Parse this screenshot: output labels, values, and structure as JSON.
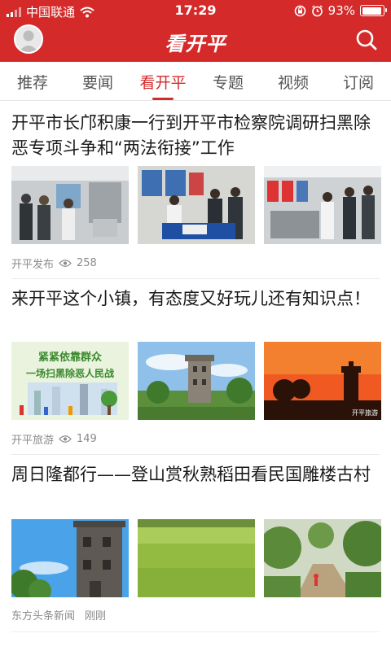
{
  "status_bar": {
    "carrier": "中国联通",
    "time": "17:29",
    "battery_text": "93%",
    "battery_level": 0.93
  },
  "header": {
    "title": "看开平",
    "avatar_icon": "user-avatar-icon",
    "search_icon": "search-icon"
  },
  "tabs": [
    {
      "label": "推荐"
    },
    {
      "label": "要闻"
    },
    {
      "label": "看开平",
      "active": true
    },
    {
      "label": "专题"
    },
    {
      "label": "视频"
    },
    {
      "label": "订阅"
    }
  ],
  "articles": [
    {
      "title": "开平市长邝积康一行到开平市检察院调研扫黑除恶专项斗争和“两法衔接”工作",
      "source": "开平发布",
      "views": "258"
    },
    {
      "title": "来开平这个小镇，有态度又好玩儿还有知识点！",
      "source": "开平旅游",
      "views": "149",
      "banner_line1": "紧紧依靠群众",
      "banner_line2": "一场扫黑除恶人民战",
      "tag": "开平旅游"
    },
    {
      "title": "周日隆都行——登山赏秋熟稻田看民国雕楼古村",
      "source": "东方头条新闻",
      "time": "刚刚"
    }
  ],
  "colors": {
    "brand": "#d42a2a",
    "text": "#1a1a1a",
    "meta": "#8a8a8a"
  }
}
